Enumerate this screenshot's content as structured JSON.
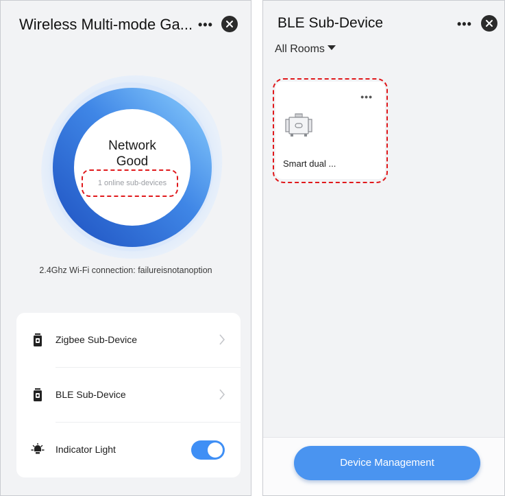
{
  "left": {
    "title": "Wireless Multi-mode Ga...",
    "more_icon": "more-horizontal-icon",
    "close_icon": "close-circle-icon",
    "network": {
      "status_line1": "Network",
      "status_line2": "Good",
      "subdevices": "1 online sub-devices"
    },
    "wifi": "2.4Ghz Wi-Fi connection: failureisnotanoption",
    "menu": [
      {
        "label": "Zigbee Sub-Device",
        "icon": "gateway-icon"
      },
      {
        "label": "BLE Sub-Device",
        "icon": "gateway-icon"
      },
      {
        "label": "Indicator Light",
        "icon": "light-icon",
        "toggle_on": true
      }
    ]
  },
  "right": {
    "title": "BLE Sub-Device",
    "rooms_filter": "All Rooms",
    "device": {
      "name": "Smart dual ...",
      "icon": "dual-switch-device-icon"
    },
    "device_mgmt": "Device Management"
  },
  "colors": {
    "accent": "#4a94f0",
    "highlight": "#e0181b",
    "ring_dark": "#2d62c6",
    "ring_light": "#7cc7ff",
    "background": "#f2f3f5"
  }
}
